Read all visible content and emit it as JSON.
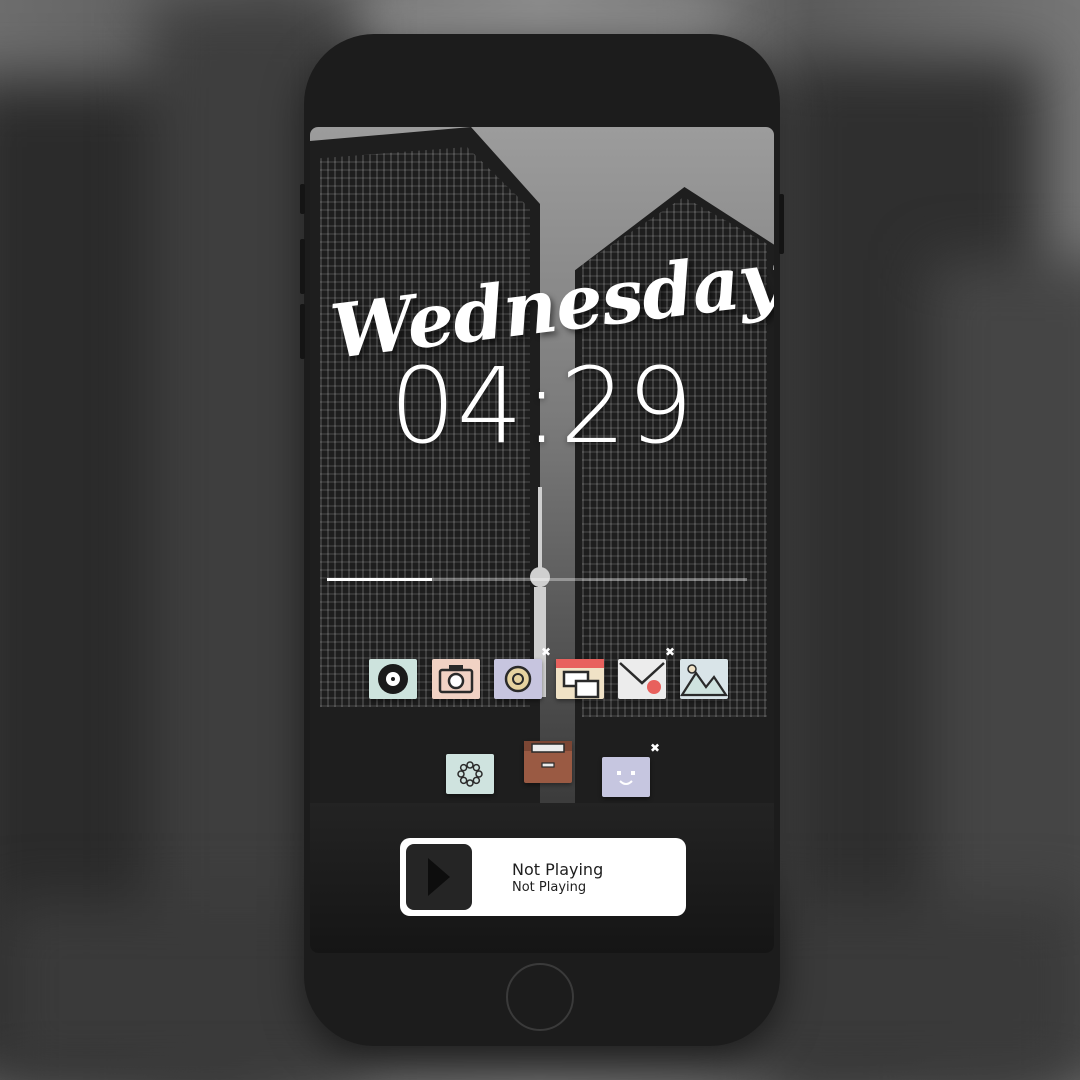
{
  "lockscreen": {
    "day": "Wednesday",
    "time": "04:29"
  },
  "progress": {
    "fraction": 0.25
  },
  "icons_row1": [
    {
      "name": "vinyl-record-icon",
      "color": "#cde3dd"
    },
    {
      "name": "camera-icon",
      "color": "#f1d2c4"
    },
    {
      "name": "music-disc-icon",
      "color": "#c7c5df"
    },
    {
      "name": "layout-window-icon",
      "color": "#f0e2c6"
    },
    {
      "name": "mail-envelope-icon",
      "color": "#ececec"
    },
    {
      "name": "photos-mountain-icon",
      "color": "#d9e4e8"
    }
  ],
  "icons_row2": [
    {
      "name": "settings-dial-icon",
      "color": "#cfe3df"
    },
    {
      "name": "cabinet-drawer-icon",
      "color": "#9a5a43"
    },
    {
      "name": "smiley-face-icon",
      "color": "#c6c6e0"
    }
  ],
  "player": {
    "title": "Not Playing",
    "subtitle": "Not Playing"
  }
}
